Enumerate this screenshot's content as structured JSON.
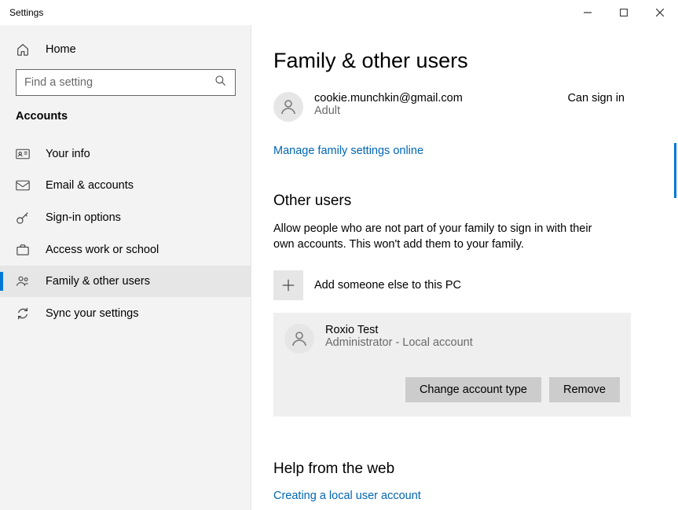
{
  "titlebar": {
    "title": "Settings"
  },
  "sidebar": {
    "home_label": "Home",
    "search_placeholder": "Find a setting",
    "section_title": "Accounts",
    "items": [
      {
        "label": "Your info"
      },
      {
        "label": "Email & accounts"
      },
      {
        "label": "Sign-in options"
      },
      {
        "label": "Access work or school"
      },
      {
        "label": "Family & other users"
      },
      {
        "label": "Sync your settings"
      }
    ]
  },
  "main": {
    "page_title": "Family & other users",
    "family_user": {
      "email": "cookie.munchkin@gmail.com",
      "sub": "Adult",
      "status": "Can sign in"
    },
    "manage_link": "Manage family settings online",
    "other_users": {
      "heading": "Other users",
      "description": "Allow people who are not part of your family to sign in with their own accounts. This won't add them to your family.",
      "add_label": "Add someone else to this PC",
      "expanded": {
        "name": "Roxio Test",
        "sub": "Administrator - Local account",
        "change_btn": "Change account type",
        "remove_btn": "Remove"
      }
    },
    "help": {
      "heading": "Help from the web",
      "link1": "Creating a local user account"
    }
  }
}
